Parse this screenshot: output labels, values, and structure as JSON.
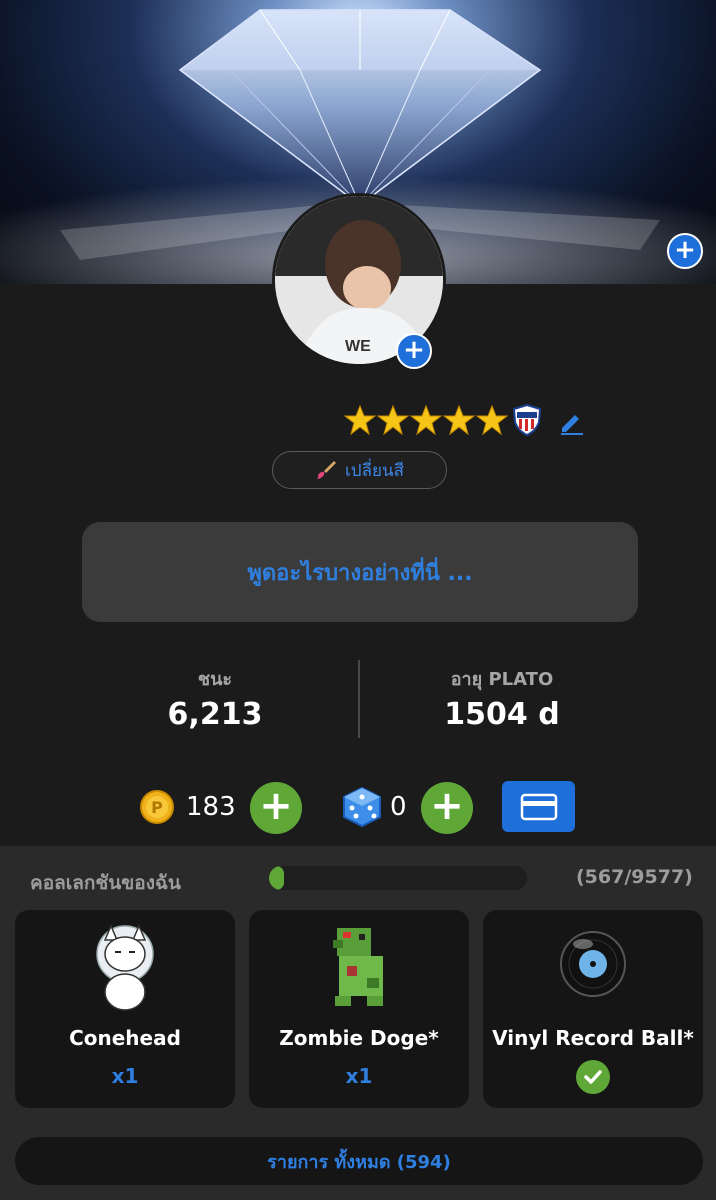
{
  "profile": {
    "rating_stars": 5,
    "change_color_label": "เปลี่ยนสี",
    "status_placeholder": "พูดอะไรบางอย่างที่นี่ ..."
  },
  "stats": {
    "wins_label": "ชนะ",
    "wins_value": "6,213",
    "age_label": "อายุ PLATO",
    "age_value": "1504 d"
  },
  "wallet": {
    "coins": "183",
    "dice": "0"
  },
  "collection": {
    "title": "คอลเลกชันของฉัน",
    "count": "(567/9577)",
    "progress": 0.059,
    "items": [
      {
        "name": "Conehead",
        "qty": "x1",
        "icon": "cat-cone-icon"
      },
      {
        "name": "Zombie Doge*",
        "qty": "x1",
        "icon": "zombie-frog-icon"
      },
      {
        "name": "Vinyl Record Ball*",
        "owned_check": true,
        "icon": "vinyl-ball-icon"
      }
    ],
    "all_items_label": "รายการ ทั้งหมด (594)"
  },
  "colors": {
    "accent_blue": "#1e6fd9",
    "link_blue": "#2f7fe0",
    "green": "#5fa838",
    "background": "#1b1b1b"
  }
}
